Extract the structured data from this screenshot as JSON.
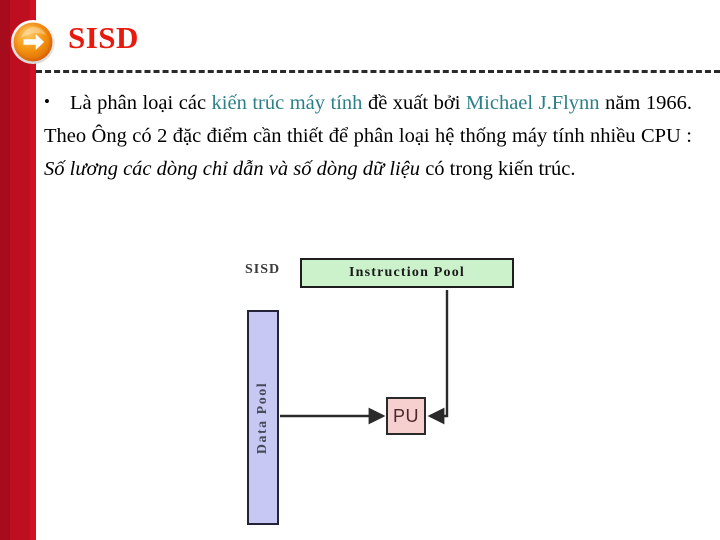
{
  "slide": {
    "title": "SISD",
    "header_icon": "right-arrow-circle-icon",
    "accent_color": "#be0f21",
    "title_color": "#e81a10",
    "highlight_color": "#2b7f87"
  },
  "body": {
    "bullet_marker": "•",
    "segments": [
      {
        "text": "Là phân loại các ",
        "style": "normal"
      },
      {
        "text": "kiến trúc máy tính",
        "style": "teal"
      },
      {
        "text": " đề xuất bởi ",
        "style": "normal"
      },
      {
        "text": "Michael J.Flynn",
        "style": "teal"
      },
      {
        "text": " năm 1966. Theo Ông có 2 đặc điểm cần thiết để phân loại hệ thống máy tính nhiều CPU : ",
        "style": "normal"
      },
      {
        "text": "Số lương các dòng chỉ dẫn và số dòng dữ liệu",
        "style": "italic"
      },
      {
        "text": " có trong kiến trúc.",
        "style": "normal"
      }
    ],
    "full_text": "• Là phân loại các kiến trúc máy tính đề xuất bởi Michael J.Flynn năm 1966. Theo Ông có 2 đặc điểm cần thiết để phân loại hệ thống máy tính nhiều CPU : Số lương các dòng chỉ dẫn và số dòng dữ liệu có trong kiến trúc."
  },
  "diagram": {
    "caption": "SISD",
    "instruction_pool": {
      "label": "Instruction Pool",
      "fill": "#ccf2cc",
      "border": "#1e1e1e"
    },
    "data_pool": {
      "label": "Data Pool",
      "fill": "#c8c8f5",
      "border": "#23233a"
    },
    "processing_unit": {
      "label": "PU",
      "fill": "#f6cfcf",
      "border": "#2a2a2a"
    },
    "connections": [
      {
        "from": "Data Pool",
        "to": "PU",
        "direction": "right"
      },
      {
        "from": "Instruction Pool",
        "to": "PU",
        "direction": "down-left"
      }
    ]
  }
}
